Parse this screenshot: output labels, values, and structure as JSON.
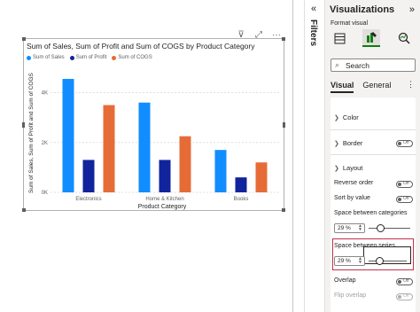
{
  "filters_pane": {
    "label": "Filters",
    "collapse_icon": "«"
  },
  "visual_header": {
    "filter_icon": "⊽",
    "focus_icon": "⤢",
    "more_icon": "···"
  },
  "chart_data": {
    "type": "bar",
    "title": "Sum of Sales, Sum of Profit and Sum of COGS by Product Category",
    "xlabel": "Product Category",
    "ylabel": "Sum of Sales, Sum of Profit and Sum of COGS",
    "categories": [
      "Electronics",
      "Home & Kitchen",
      "Books"
    ],
    "yticks": [
      "0K",
      "2K",
      "4K"
    ],
    "ylim": [
      0,
      4800
    ],
    "series": [
      {
        "name": "Sum of Sales",
        "color": "#118DFF",
        "values": [
          4550,
          3600,
          1700
        ]
      },
      {
        "name": "Sum of Profit",
        "color": "#12239E",
        "values": [
          1300,
          1300,
          600
        ]
      },
      {
        "name": "Sum of COGS",
        "color": "#E66C37",
        "values": [
          3500,
          2250,
          1200
        ]
      }
    ],
    "legend_position": "top-left",
    "grid": true
  },
  "viz_pane": {
    "title": "Visualizations",
    "collapse_icon": "»",
    "format_label": "Format visual",
    "icons": [
      "table-build-icon",
      "format-brush-icon",
      "analytics-icon"
    ],
    "search": {
      "placeholder": "Search"
    },
    "tabs": {
      "visual": "Visual",
      "general": "General",
      "more": "⋮"
    },
    "sections": {
      "color": "Color",
      "border": "Border",
      "border_toggle": "Off",
      "layout": "Layout"
    },
    "options": {
      "reverse_order": "Reverse order",
      "reverse_order_toggle": "Off",
      "sort_by_value": "Sort by value",
      "sort_by_value_toggle": "Off",
      "space_categories": "Space between categories",
      "space_categories_value": "29 %",
      "space_categories_pct": 29,
      "space_series": "Space between series",
      "space_series_value": "29 %",
      "space_series_pct": 29,
      "overlap": "Overlap",
      "overlap_toggle": "Off",
      "flip_overlap": "Flip overlap",
      "flip_overlap_toggle": "Off"
    }
  }
}
